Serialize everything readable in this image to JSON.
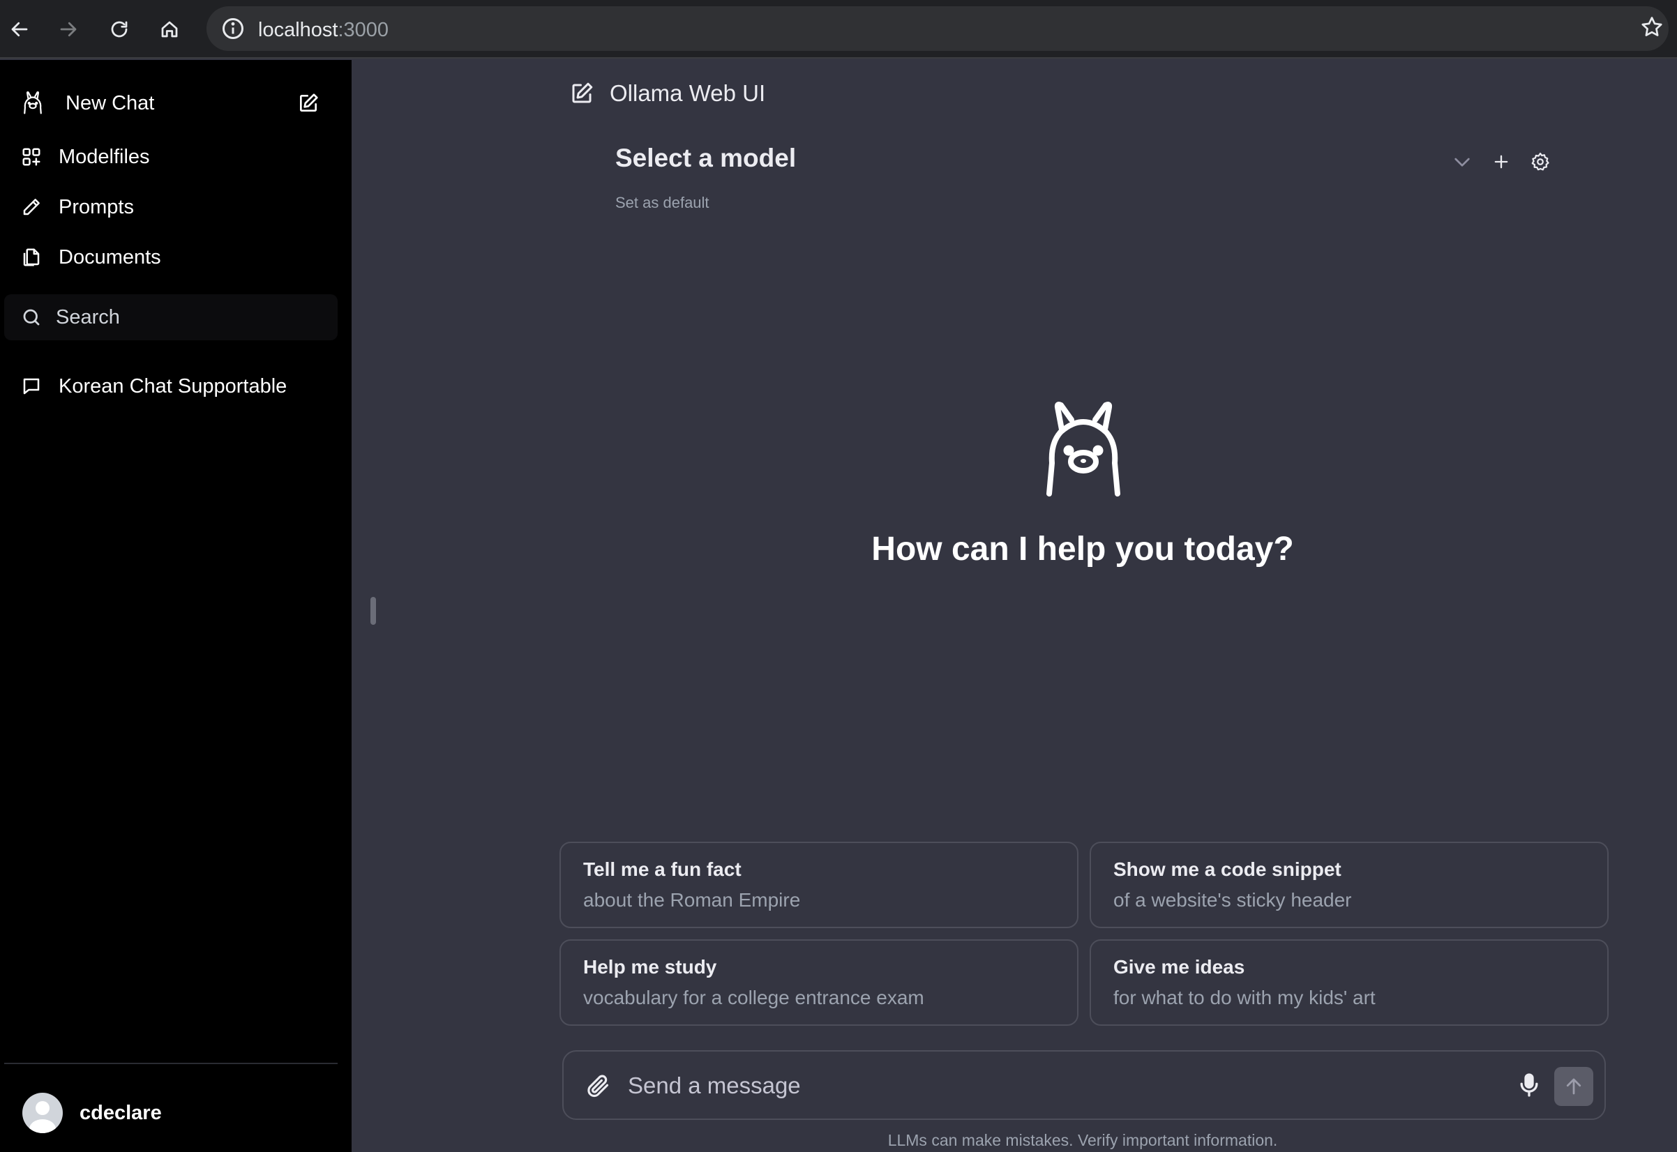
{
  "browser": {
    "url_host": "localhost",
    "url_port": ":3000"
  },
  "sidebar": {
    "new_chat_label": "New Chat",
    "items": [
      {
        "label": "Modelfiles",
        "icon": "grid-plus-icon"
      },
      {
        "label": "Prompts",
        "icon": "pencil-icon"
      },
      {
        "label": "Documents",
        "icon": "documents-icon"
      }
    ],
    "search_placeholder": "Search",
    "chats": [
      {
        "label": "Korean Chat Supportable",
        "icon": "chat-bubble-icon"
      }
    ],
    "user": {
      "name": "cdeclare"
    }
  },
  "header": {
    "title": "Ollama Web UI",
    "model_select_label": "Select a model",
    "set_default_label": "Set as default"
  },
  "main": {
    "greeting": "How can I help you today?",
    "suggestions": [
      {
        "title": "Tell me a fun fact",
        "subtitle": "about the Roman Empire"
      },
      {
        "title": "Show me a code snippet",
        "subtitle": "of a website's sticky header"
      },
      {
        "title": "Help me study",
        "subtitle": "vocabulary for a college entrance exam"
      },
      {
        "title": "Give me ideas",
        "subtitle": "for what to do with my kids' art"
      }
    ]
  },
  "composer": {
    "placeholder": "Send a message",
    "disclaimer": "LLMs can make mistakes. Verify important information."
  },
  "colors": {
    "sidebar_bg": "#000000",
    "main_bg": "#343541",
    "border": "#4d4e5a",
    "muted_text": "#9ca3af"
  }
}
